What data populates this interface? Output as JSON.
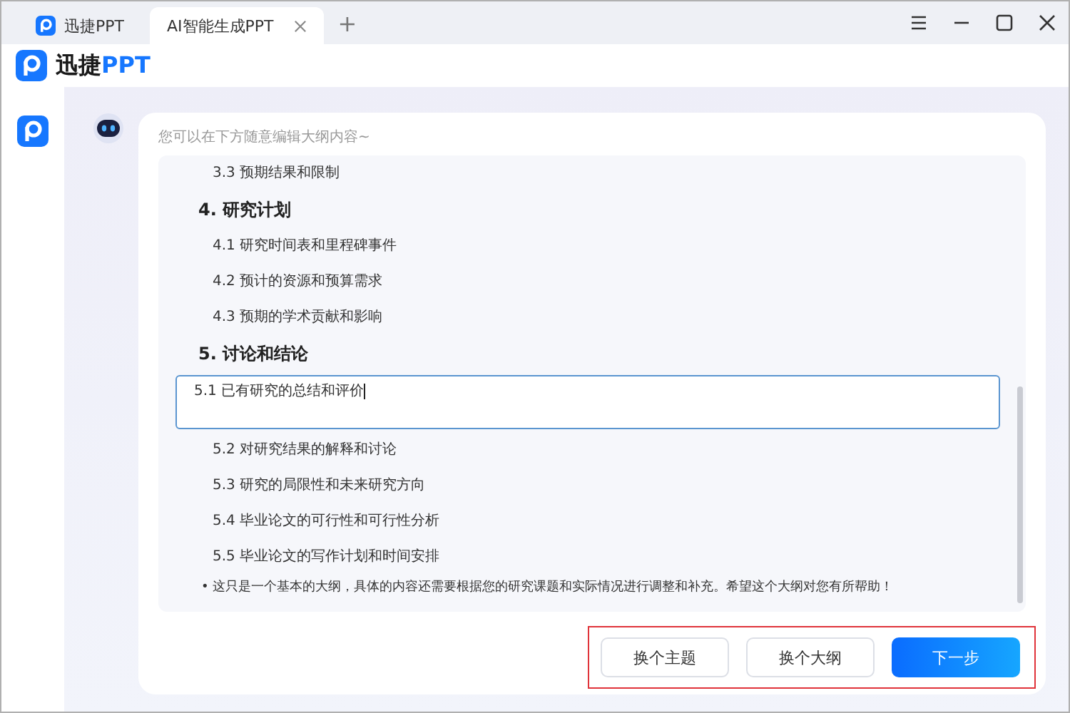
{
  "tabs": [
    {
      "label": "迅捷PPT",
      "selected": false,
      "closable": false
    },
    {
      "label": "AI智能生成PPT",
      "selected": true,
      "closable": true
    }
  ],
  "new_tab": "+",
  "app_header": {
    "brand": "迅捷",
    "brand_accent": "PPT"
  },
  "hint": "您可以在下方随意编辑大纲内容~",
  "outline": [
    {
      "kind": "item",
      "text": "3.3  预期结果和限制"
    },
    {
      "kind": "heading",
      "text": "4. 研究计划"
    },
    {
      "kind": "item",
      "text": "4.1  研究时间表和里程碑事件"
    },
    {
      "kind": "item",
      "text": "4.2  预计的资源和预算需求"
    },
    {
      "kind": "item",
      "text": "4.3  预期的学术贡献和影响"
    },
    {
      "kind": "heading",
      "text": "5. 讨论和结论"
    },
    {
      "kind": "editing",
      "text": "5.1  已有研究的总结和评价"
    },
    {
      "kind": "item",
      "text": "5.2  对研究结果的解释和讨论"
    },
    {
      "kind": "item",
      "text": "5.3  研究的局限性和未来研究方向"
    },
    {
      "kind": "item",
      "text": "5.4  毕业论文的可行性和可行性分析"
    },
    {
      "kind": "item",
      "text": "5.5  毕业论文的写作计划和时间安排"
    },
    {
      "kind": "note",
      "text": "• 这只是一个基本的大纲，具体的内容还需要根据您的研究课题和实际情况进行调整和补充。希望这个大纲对您有所帮助！"
    }
  ],
  "buttons": [
    {
      "label": "换个主题",
      "kind": "secondary"
    },
    {
      "label": "换个大纲",
      "kind": "secondary"
    },
    {
      "label": "下一步",
      "kind": "primary"
    }
  ]
}
